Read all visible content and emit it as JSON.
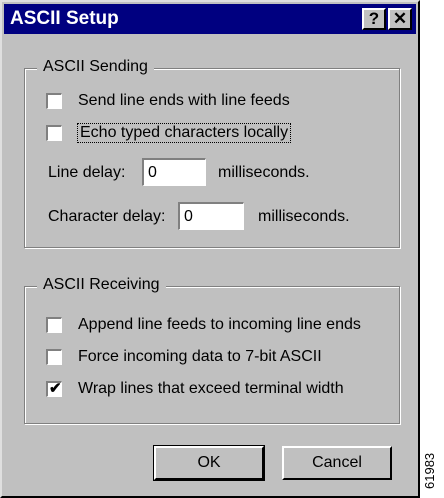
{
  "window": {
    "title": "ASCII Setup",
    "help_button": "?",
    "close_button": "✕"
  },
  "sending": {
    "legend": "ASCII Sending",
    "send_line_ends": {
      "label": "Send line ends with line feeds",
      "checked": false
    },
    "echo_typed": {
      "label": "Echo typed characters locally",
      "checked": false
    },
    "line_delay": {
      "label": "Line delay:",
      "value": "0",
      "unit": "milliseconds."
    },
    "character_delay": {
      "label": "Character delay:",
      "value": "0",
      "unit": "milliseconds."
    }
  },
  "receiving": {
    "legend": "ASCII Receiving",
    "append_line_feeds": {
      "label": "Append line feeds to incoming line ends",
      "checked": false
    },
    "force_7bit": {
      "label": "Force incoming data to 7-bit ASCII",
      "checked": false
    },
    "wrap_lines": {
      "label": "Wrap lines that exceed terminal width",
      "checked": true
    }
  },
  "buttons": {
    "ok": "OK",
    "cancel": "Cancel"
  },
  "figure_id": "61983"
}
